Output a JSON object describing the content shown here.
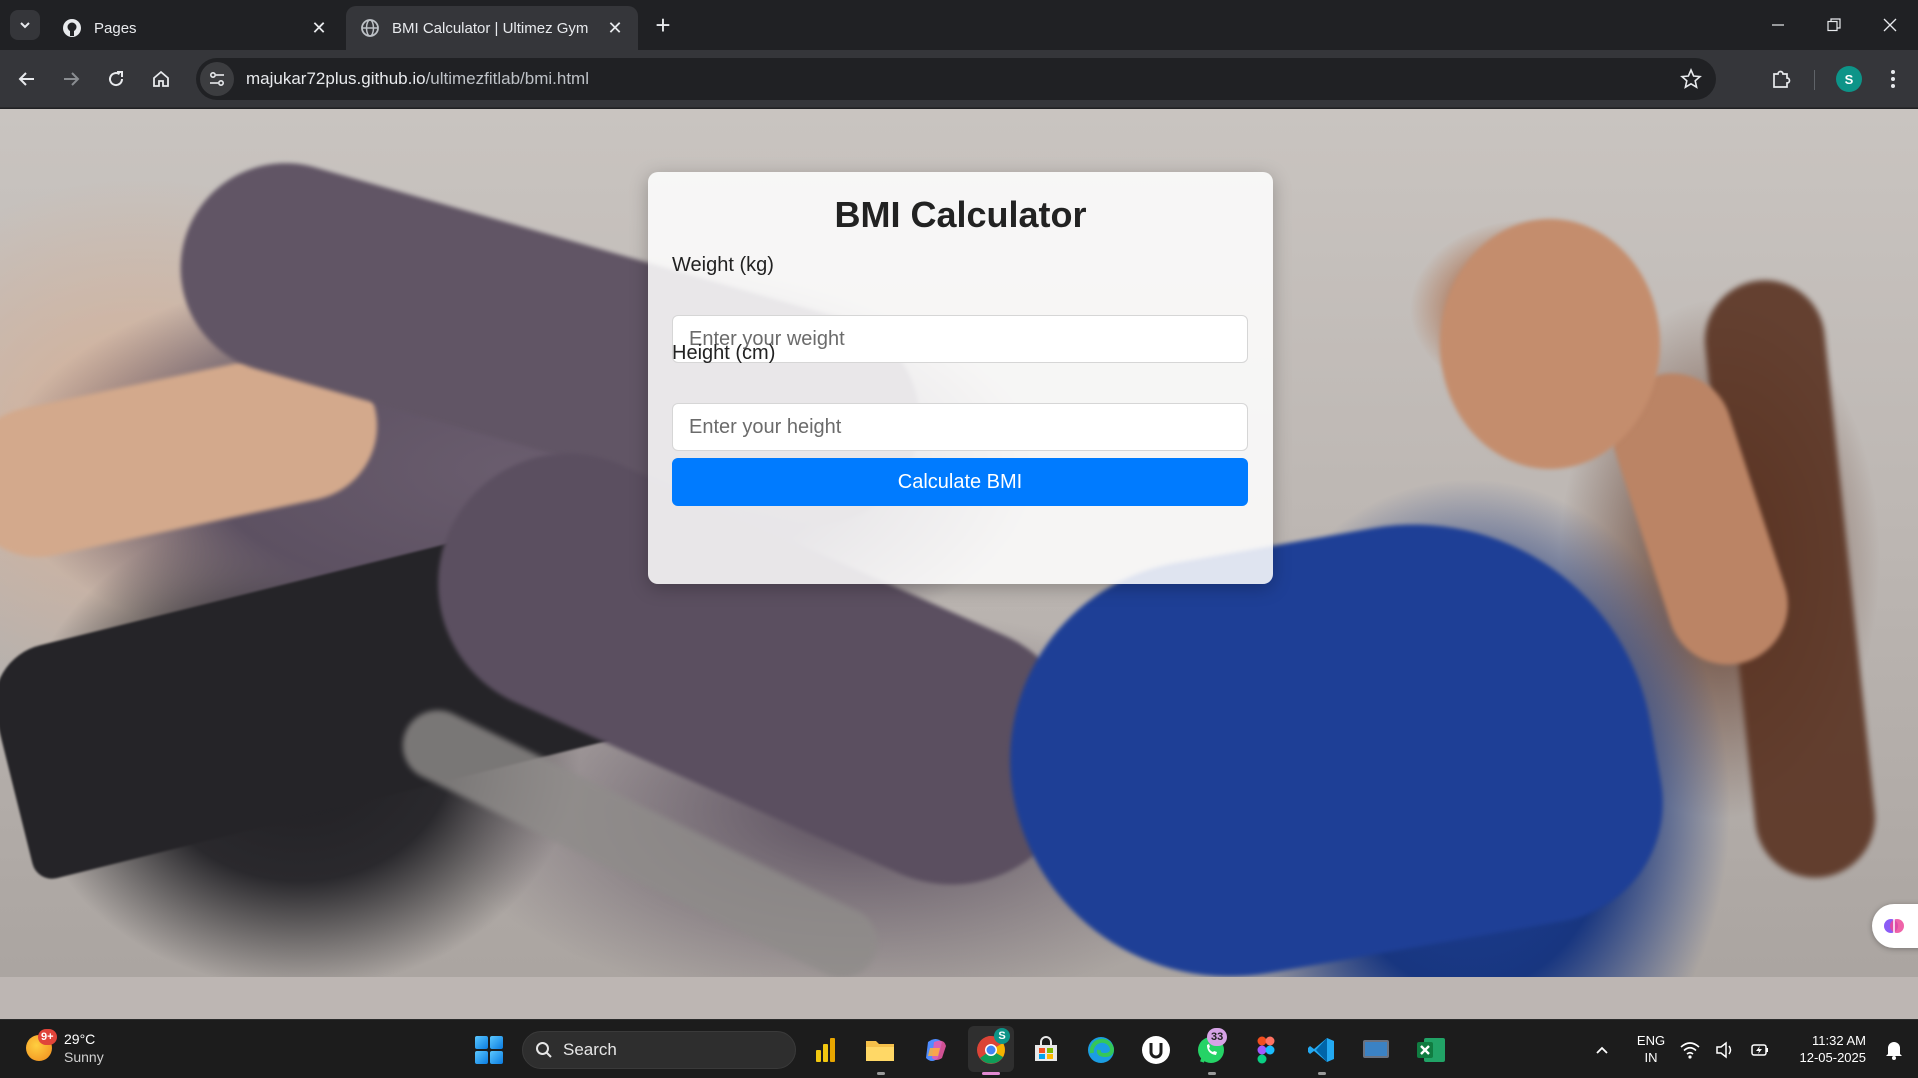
{
  "browser": {
    "tabs": [
      {
        "title": "Pages",
        "favicon": "github-icon"
      },
      {
        "title": "BMI Calculator | Ultimez Gym",
        "favicon": "globe-icon"
      }
    ],
    "url_host": "majukar72plus.github.io",
    "url_path": "/ultimezfitlab/bmi.html",
    "profile_initial": "S"
  },
  "page": {
    "title": "BMI Calculator",
    "weight_label": "Weight (kg)",
    "weight_placeholder": "Enter your weight",
    "weight_value": "",
    "height_label": "Height (cm)",
    "height_placeholder": "Enter your height",
    "height_value": "",
    "button_label": "Calculate BMI",
    "colors": {
      "button": "#007bff",
      "card": "#ffffff"
    }
  },
  "taskbar": {
    "weather_badge": "9+",
    "temperature": "29°C",
    "condition": "Sunny",
    "search_label": "Search",
    "whatsapp_badge": "33",
    "chrome_badge": "S",
    "lang_line1": "ENG",
    "lang_line2": "IN",
    "time": "11:32 AM",
    "date": "12-05-2025"
  }
}
